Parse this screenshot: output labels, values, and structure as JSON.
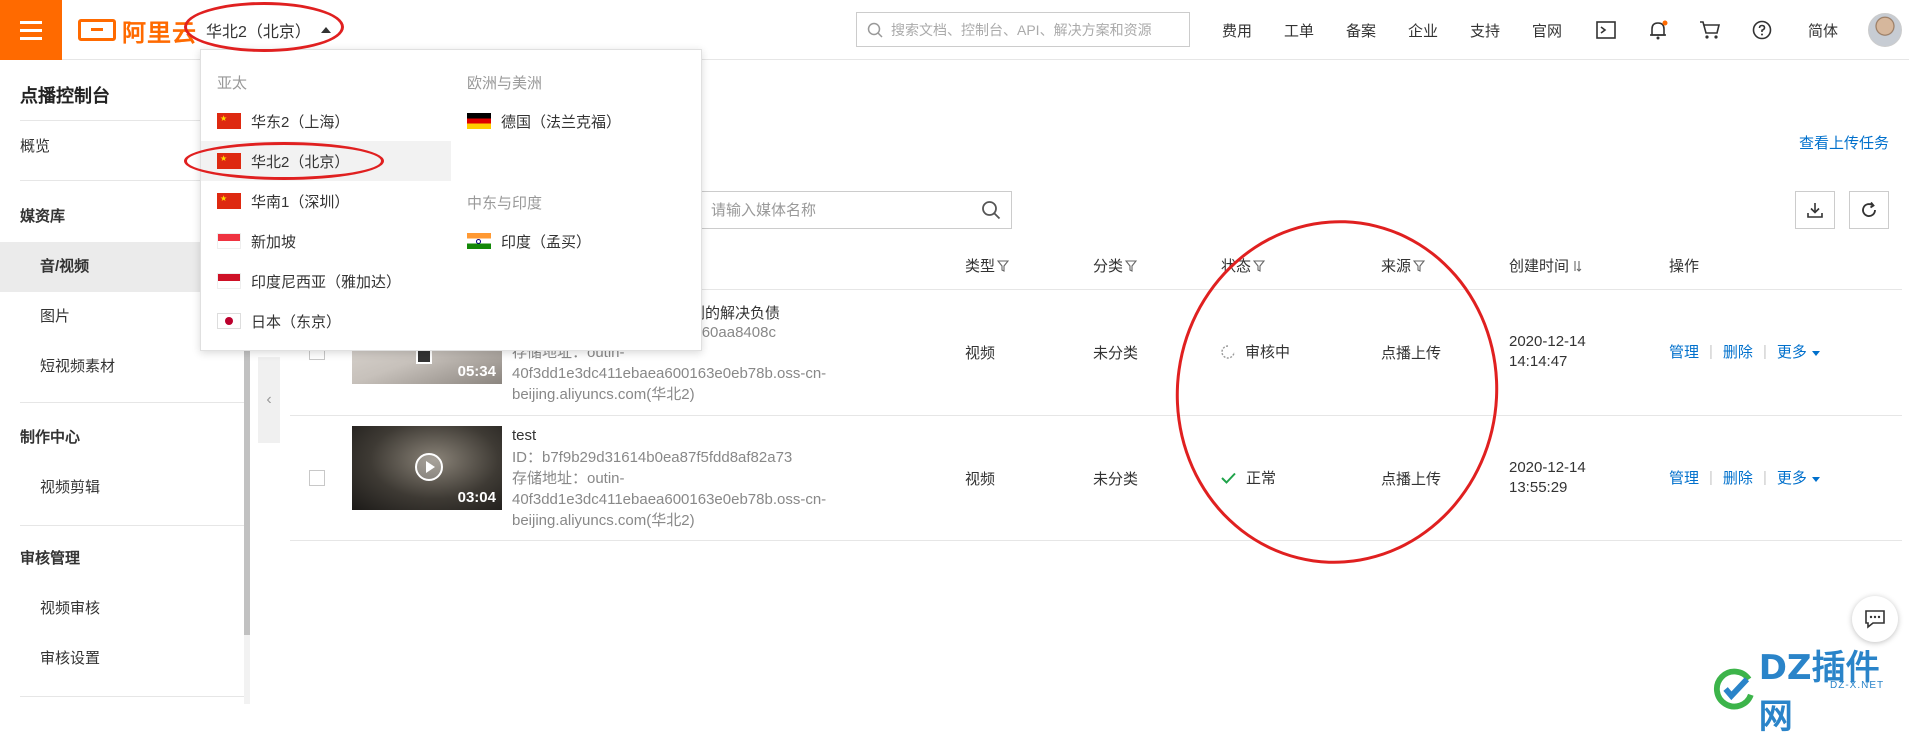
{
  "topbar": {
    "logo_text": "阿里云",
    "region_current": "华北2（北京）",
    "search_placeholder": "搜索文档、控制台、API、解决方案和资源",
    "nav": [
      "费用",
      "工单",
      "备案",
      "企业",
      "支持",
      "官网"
    ],
    "lang": "简体"
  },
  "sidebar": {
    "title": "点播控制台",
    "overview": "概览",
    "media_group": "媒资库",
    "media_items": [
      "音/视频",
      "图片",
      "短视频素材"
    ],
    "make_group": "制作中心",
    "make_items": [
      "视频剪辑"
    ],
    "audit_group": "审核管理",
    "audit_items": [
      "视频审核",
      "审核设置"
    ]
  },
  "main": {
    "upload_task_link": "查看上传任务",
    "media_search_placeholder": "请输入媒体名称",
    "columns": {
      "type": "类型",
      "category": "分类",
      "status": "状态",
      "source": "来源",
      "created": "创建时间",
      "actions": "操作"
    },
    "rows": [
      {
        "name_partial": "有规划的解决负债",
        "id_partial": "04e5560aa8408c",
        "storage_1": "存储地址：outin-",
        "storage_2": "40f3dd1e3dc411ebaea600163e0eb78b.oss-cn-",
        "storage_3": "beijing.aliyuncs.com(华北2)",
        "duration": "05:34",
        "type": "视频",
        "category": "未分类",
        "status": "审核中",
        "source": "点播上传",
        "date": "2020-12-14",
        "time": "14:14:47",
        "op_manage": "管理",
        "op_delete": "删除",
        "op_more": "更多"
      },
      {
        "name": "test",
        "id": "ID：b7f9b29d31614b0ea87f5fdd8af82a73",
        "storage_1": "存储地址：outin-",
        "storage_2": "40f3dd1e3dc411ebaea600163e0eb78b.oss-cn-",
        "storage_3": "beijing.aliyuncs.com(华北2)",
        "duration": "03:04",
        "type": "视频",
        "category": "未分类",
        "status": "正常",
        "source": "点播上传",
        "date": "2020-12-14",
        "time": "13:55:29",
        "op_manage": "管理",
        "op_delete": "删除",
        "op_more": "更多"
      }
    ]
  },
  "region_dropdown": {
    "apac_header": "亚太",
    "apac": [
      "华东2（上海）",
      "华北2（北京）",
      "华南1（深圳）",
      "新加坡",
      "印度尼西亚（雅加达）",
      "日本（东京）"
    ],
    "eu_header": "欧洲与美洲",
    "eu": [
      "德国（法兰克福）"
    ],
    "me_header": "中东与印度",
    "me": [
      "印度（孟买）"
    ]
  },
  "watermark": {
    "text": "DZ插件网",
    "sub": "DZ-X.NET"
  },
  "colors": {
    "brand": "#ff6a00",
    "link": "#0070cc",
    "annotation": "#e02020",
    "success": "#1fa34a"
  }
}
